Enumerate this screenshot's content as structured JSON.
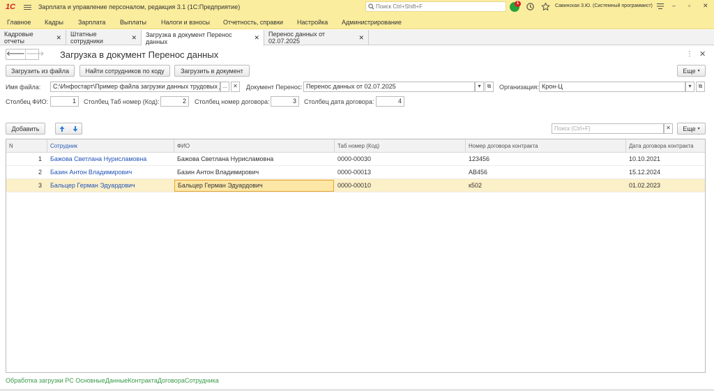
{
  "app": {
    "title": "Зарплата и управление персоналом, редакция 3.1  (1С:Предприятие)",
    "logo": "1С",
    "search_placeholder": "Поиск Ctrl+Shift+F",
    "notification_count": "1",
    "user": "Савинская З.Ю. (Системный программист)"
  },
  "menu": [
    "Главное",
    "Кадры",
    "Зарплата",
    "Выплаты",
    "Налоги и взносы",
    "Отчетность, справки",
    "Настройка",
    "Администрирование"
  ],
  "tabs": [
    {
      "label": "Кадровые отчеты"
    },
    {
      "label": "Штатные сотрудники"
    },
    {
      "label": "Загрузка в документ Перенос данных"
    },
    {
      "label": "Перенос данных  от 02.07.2025"
    }
  ],
  "form": {
    "title": "Загрузка в документ Перенос данных",
    "buttons": {
      "load_file": "Загрузить из файла",
      "find_employees": "Найти сотрудников по коду",
      "load_doc": "Загрузить в документ",
      "more": "Еще",
      "add": "Добавить",
      "more2": "Еще"
    },
    "file_label": "Имя файла:",
    "file_value": "C:\\Инфостарт\\Пример файла загрузки данных трудовых до",
    "doc_label": "Документ Перенос:",
    "doc_value": "Перенос данных  от 02.07.2025",
    "org_label": "Организация:",
    "org_value": "Крон-Ц",
    "col_fio_label": "Столбец ФИО:",
    "col_fio_value": "1",
    "col_tab_label": "Столбец Таб номер (Код):",
    "col_tab_value": "2",
    "col_contract_label": "Столбец номер договора:",
    "col_contract_value": "3",
    "col_date_label": "Столбец дата договора:",
    "col_date_value": "4",
    "table_search_placeholder": "Поиск (Ctrl+F)"
  },
  "table": {
    "columns": [
      "N",
      "Сотрудник",
      "ФИО",
      "Таб номер (Код)",
      "Номер договора контракта",
      "Дата договора контракта"
    ],
    "rows": [
      [
        "1",
        "Бажова Светлана Нурисламовна",
        "Бажова Светлана Нурисламовна",
        "0000-00030",
        "123456",
        "10.10.2021"
      ],
      [
        "2",
        "Базин Антон Владимирович",
        "Базин Антон Владимирович",
        "0000-00013",
        "AB456",
        "15.12.2024"
      ],
      [
        "3",
        "Бальцер Герман Эдуардович",
        "Бальцер Герман Эдуардович",
        "0000-00010",
        "к502",
        "01.02.2023"
      ]
    ]
  },
  "footer": "Обработка загрузки РС ОсновныеДанныеКонтрактаДоговораСотрудника"
}
